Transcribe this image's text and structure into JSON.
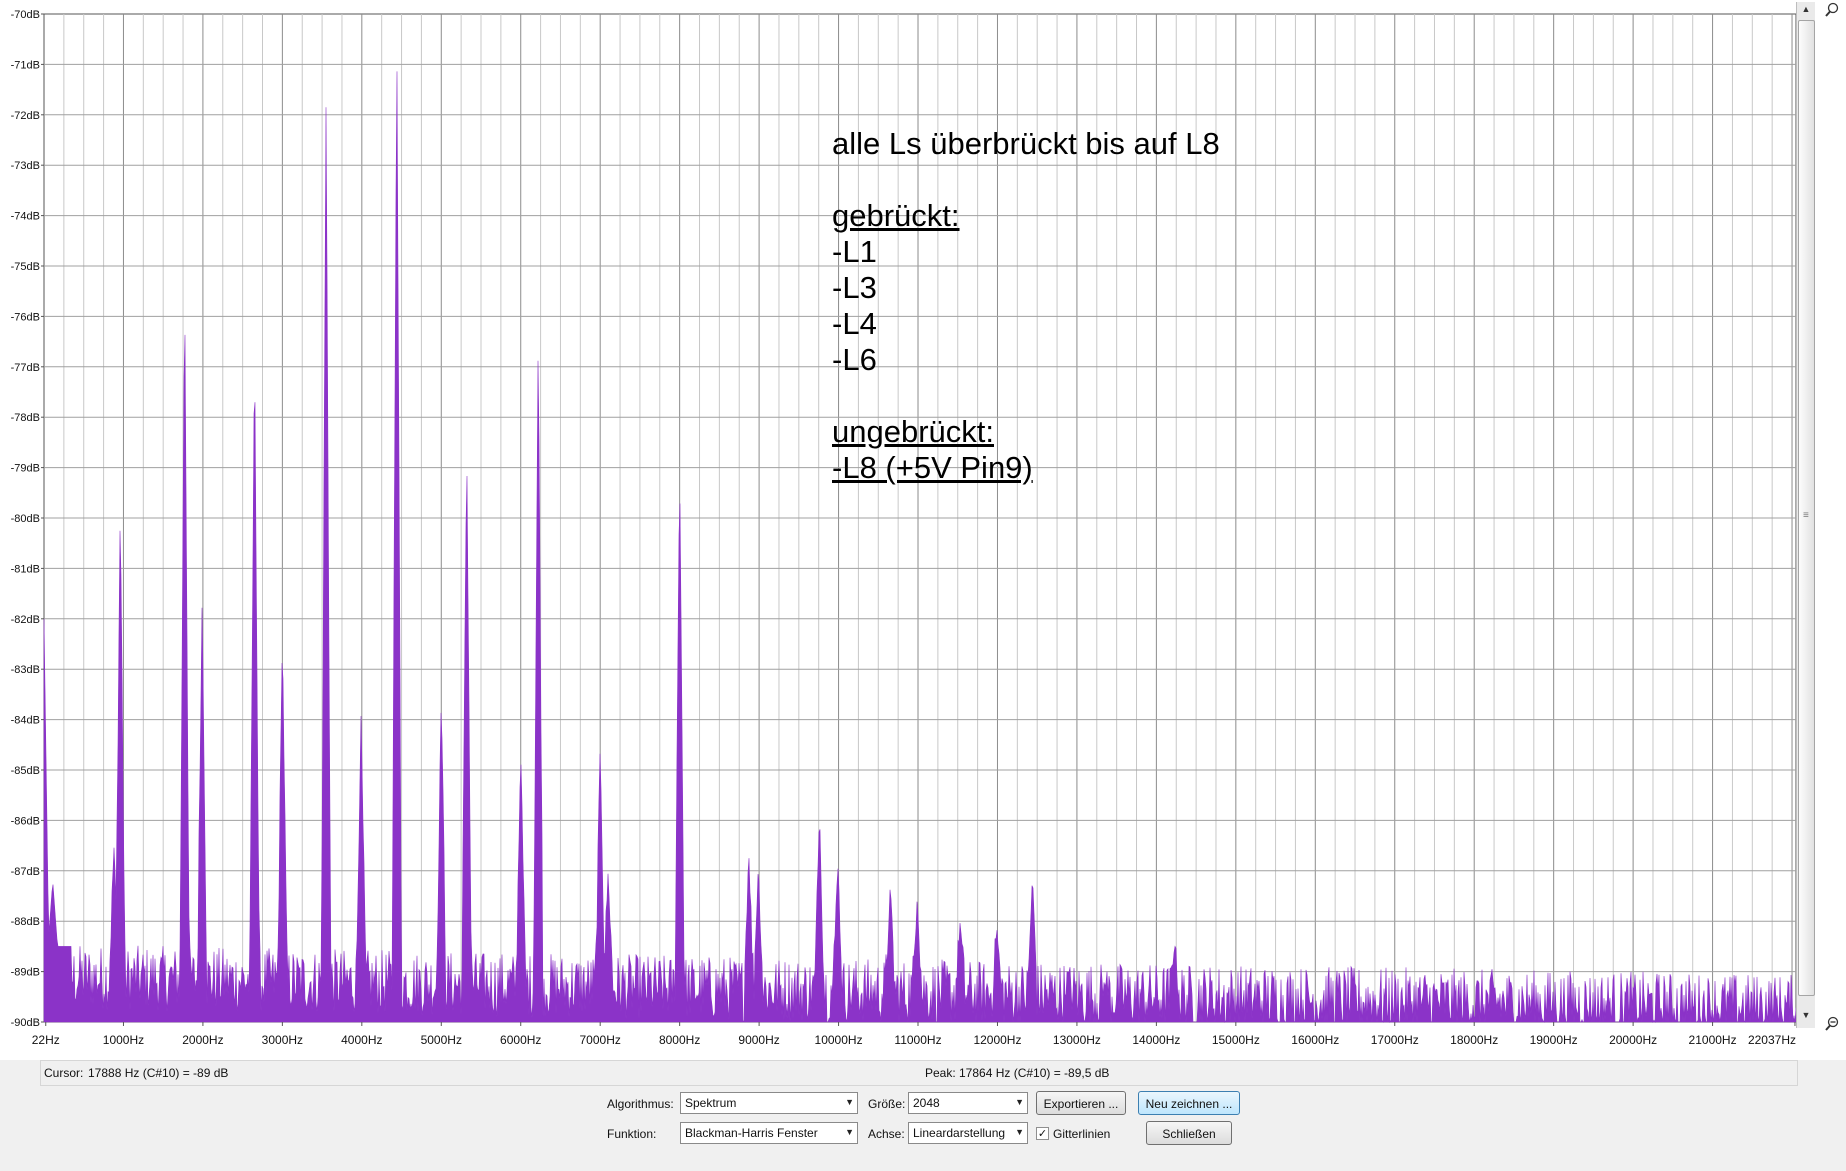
{
  "plot": {
    "y_labels": [
      "-70dB",
      "-71dB",
      "-72dB",
      "-73dB",
      "-74dB",
      "-75dB",
      "-76dB",
      "-77dB",
      "-78dB",
      "-79dB",
      "-80dB",
      "-81dB",
      "-82dB",
      "-83dB",
      "-84dB",
      "-85dB",
      "-86dB",
      "-87dB",
      "-88dB",
      "-89dB",
      "-90dB"
    ],
    "x_labels": [
      "22Hz",
      "1000Hz",
      "2000Hz",
      "3000Hz",
      "4000Hz",
      "5000Hz",
      "6000Hz",
      "7000Hz",
      "8000Hz",
      "9000Hz",
      "10000Hz",
      "11000Hz",
      "12000Hz",
      "13000Hz",
      "14000Hz",
      "15000Hz",
      "16000Hz",
      "17000Hz",
      "18000Hz",
      "19000Hz",
      "20000Hz",
      "21000Hz",
      "22037Hz"
    ],
    "x_tick_freqs": [
      22,
      1000,
      2000,
      3000,
      4000,
      5000,
      6000,
      7000,
      8000,
      9000,
      10000,
      11000,
      12000,
      13000,
      14000,
      15000,
      16000,
      17000,
      18000,
      19000,
      20000,
      21000,
      22037
    ],
    "spectrum_color": "#8b33c8",
    "peaks": [
      {
        "f": 0,
        "db": -82.0
      },
      {
        "f": 110,
        "db": -87.2
      },
      {
        "f": 880,
        "db": -86.5
      },
      {
        "f": 960,
        "db": -79.7
      },
      {
        "f": 1770,
        "db": -75.3
      },
      {
        "f": 1990,
        "db": -81.6
      },
      {
        "f": 2650,
        "db": -76.5
      },
      {
        "f": 3000,
        "db": -82.3
      },
      {
        "f": 3550,
        "db": -71.6
      },
      {
        "f": 3990,
        "db": -83.9
      },
      {
        "f": 4440,
        "db": -70.3
      },
      {
        "f": 5000,
        "db": -83.5
      },
      {
        "f": 5320,
        "db": -78.5
      },
      {
        "f": 6000,
        "db": -84.6
      },
      {
        "f": 6220,
        "db": -76.3
      },
      {
        "f": 7000,
        "db": -84.5
      },
      {
        "f": 7100,
        "db": -87.0
      },
      {
        "f": 8000,
        "db": -78.9
      },
      {
        "f": 8870,
        "db": -86.6
      },
      {
        "f": 8990,
        "db": -86.9
      },
      {
        "f": 9760,
        "db": -85.8
      },
      {
        "f": 9990,
        "db": -86.8
      },
      {
        "f": 10650,
        "db": -87.3
      },
      {
        "f": 10990,
        "db": -87.5
      },
      {
        "f": 11530,
        "db": -88.0
      },
      {
        "f": 11990,
        "db": -88.1
      },
      {
        "f": 12440,
        "db": -87.1
      },
      {
        "f": 12890,
        "db": -89.0
      },
      {
        "f": 13360,
        "db": -89.2
      },
      {
        "f": 14230,
        "db": -88.4
      }
    ]
  },
  "annotation": {
    "line1": "alle Ls überbrückt bis auf L8",
    "heading1": "gebrückt:",
    "items1": [
      "-L1",
      "-L3",
      "-L4",
      "-L6"
    ],
    "heading2": "ungebrückt:",
    "items2": [
      "-L8 (+5V Pin9)"
    ]
  },
  "status": {
    "cursor_label": "Cursor:",
    "cursor_value": "17888 Hz (C#10) = -89 dB",
    "peak_label": "Peak:",
    "peak_value": "17864 Hz (C#10) = -89,5 dB"
  },
  "controls": {
    "algorithm_label": "Algorithmus:",
    "algorithm_value": "Spektrum",
    "size_label": "Größe:",
    "size_value": "2048",
    "export_button": "Exportieren ...",
    "redraw_button": "Neu zeichnen ...",
    "function_label": "Funktion:",
    "function_value": "Blackman-Harris Fenster",
    "axis_label": "Achse:",
    "axis_value": "Lineardarstellung",
    "gridlines_label": "Gitterlinien",
    "gridlines_checked": true,
    "close_button": "Schließen"
  }
}
